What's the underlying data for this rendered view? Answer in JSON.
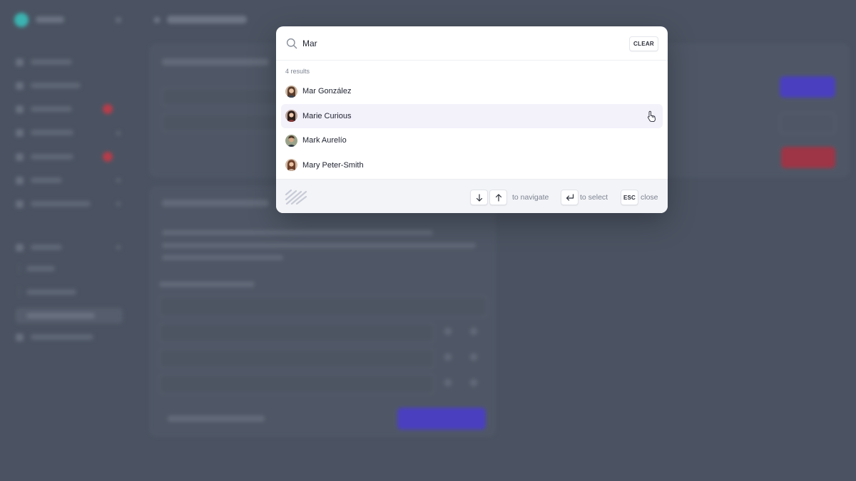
{
  "search": {
    "value": "Mar",
    "clear_label": "CLEAR"
  },
  "results_count": "4 results",
  "results": [
    {
      "name": "Mar González",
      "avatar": "avatar-photo"
    },
    {
      "name": "Marie Curious",
      "avatar": "avatar-photo",
      "highlighted": true
    },
    {
      "name": "Mark Aurelío",
      "avatar": "avatar-photo"
    },
    {
      "name": "Mary Peter-Smith",
      "avatar": "avatar-photo"
    }
  ],
  "footer": {
    "navigate_hint": "to navigate",
    "select_hint": "to select",
    "esc_key": "ESC",
    "close_hint": "close",
    "icons": [
      "arrow-down-icon",
      "arrow-up-icon",
      "enter-key-icon"
    ]
  },
  "colors": {
    "overlay": "#4b5362",
    "highlight_row": "#f3f1fa",
    "accent_purple": "#4f46e5",
    "danger_red": "#c0344a",
    "brand_teal": "#3bb3b0"
  }
}
